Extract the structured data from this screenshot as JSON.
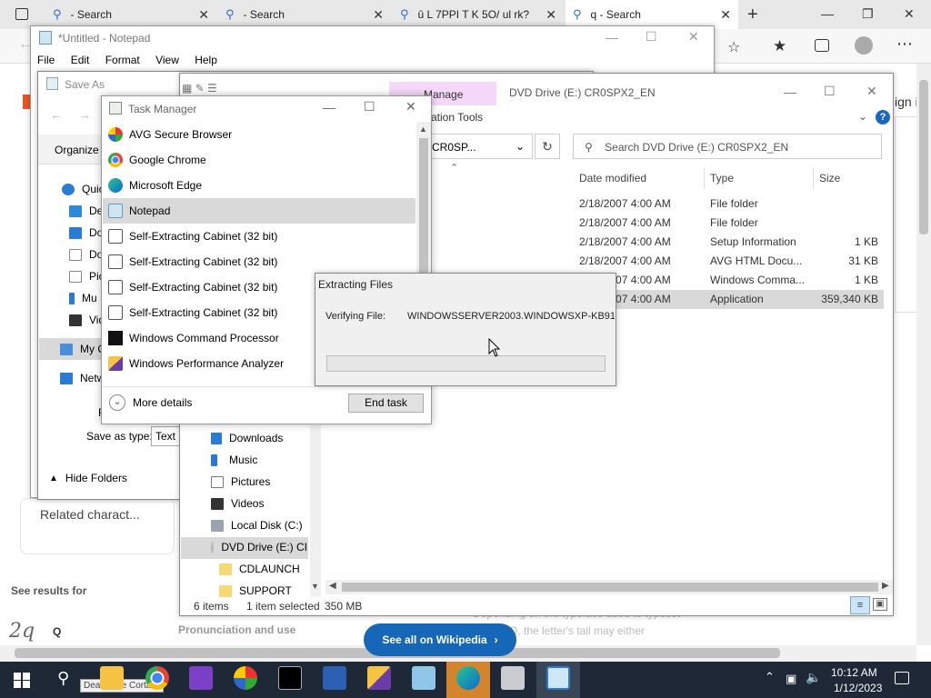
{
  "browser": {
    "tabs": [
      {
        "label": "- Search"
      },
      {
        "label": "- Search"
      },
      {
        "label": "û L 7PPI T K 5O/ ul rk?"
      },
      {
        "label": "q - Search"
      }
    ],
    "right_text": "ign i",
    "bg_text_related": "Related charact...",
    "bg_text_see_results": "See results for",
    "bg_text_q": "Q",
    "bg_text_pronunciation": "Pronunciation and use",
    "bg_text_depending": "Depending on the typeface used to typeset",
    "bg_text_tail": "Q, the letter's tail may either",
    "wiki_button": "See all on Wikipedia"
  },
  "notepad": {
    "title": "*Untitled - Notepad",
    "menu": [
      "File",
      "Edit",
      "Format",
      "View",
      "Help"
    ]
  },
  "save_as": {
    "title": "Save As",
    "organize": "Organize",
    "nav": [
      "Quic",
      "Des",
      "Do",
      "Doc",
      "Pic",
      "Mu",
      "Vid",
      "My C",
      "Netw"
    ],
    "f_label": "F",
    "save_type_label": "Save as type:",
    "save_type_value": "Text D",
    "hide_folders": "Hide Folders"
  },
  "task_manager": {
    "title": "Task Manager",
    "apps": [
      {
        "name": "AVG Secure Browser",
        "icon": "avg-icon"
      },
      {
        "name": "Google Chrome",
        "icon": "chrome-icon"
      },
      {
        "name": "Microsoft Edge",
        "icon": "edge-icon"
      },
      {
        "name": "Notepad",
        "icon": "notepad-icon"
      },
      {
        "name": "Self-Extracting Cabinet (32 bit)",
        "icon": "cabinet-icon"
      },
      {
        "name": "Self-Extracting Cabinet (32 bit)",
        "icon": "cabinet-icon"
      },
      {
        "name": "Self-Extracting Cabinet (32 bit)",
        "icon": "cabinet-icon"
      },
      {
        "name": "Self-Extracting Cabinet (32 bit)",
        "icon": "cabinet-icon"
      },
      {
        "name": "Windows Command Processor",
        "icon": "cmd-icon"
      },
      {
        "name": "Windows Performance Analyzer",
        "icon": "wpa-icon"
      }
    ],
    "selected_index": 3,
    "more_details": "More details",
    "end_task": "End task"
  },
  "explorer": {
    "manage_tab": "Manage",
    "app_tools": "ation Tools",
    "title": "DVD Drive (E:) CR0SPX2_EN",
    "address": "CR0SP...",
    "search_placeholder": "Search DVD Drive (E:) CR0SPX2_EN",
    "columns": {
      "date": "Date modified",
      "type": "Type",
      "size": "Size"
    },
    "rows": [
      {
        "date": "2/18/2007 4:00 AM",
        "type": "File folder",
        "size": ""
      },
      {
        "date": "2/18/2007 4:00 AM",
        "type": "File folder",
        "size": ""
      },
      {
        "date": "2/18/2007 4:00 AM",
        "type": "Setup Information",
        "size": "1 KB"
      },
      {
        "date": "2/18/2007 4:00 AM",
        "type": "AVG HTML Docu...",
        "size": "31 KB"
      },
      {
        "date": "2/18/2007 4:00 AM",
        "type": "Windows Comma...",
        "size": "1 KB"
      },
      {
        "date": "2/18/2007 4:00 AM",
        "type": "Application",
        "size": "359,340 KB"
      }
    ],
    "nav": [
      "Downloads",
      "Music",
      "Pictures",
      "Videos",
      "Local Disk (C:)",
      "DVD Drive (E:) CI",
      "CDLAUNCH",
      "SUPPORT"
    ],
    "status_items": "6 items",
    "status_selected": "1 item selected",
    "status_size": "350 MB"
  },
  "extract": {
    "title": "Extracting Files",
    "label": "Verifying File:",
    "file": "WINDOWSSERVER2003.WINDOWSXP-KB91",
    "progress": 0
  },
  "taskbar": {
    "time": "10:12 AM",
    "date": "1/12/2023",
    "tooltip": "Deactivate Cortana"
  }
}
